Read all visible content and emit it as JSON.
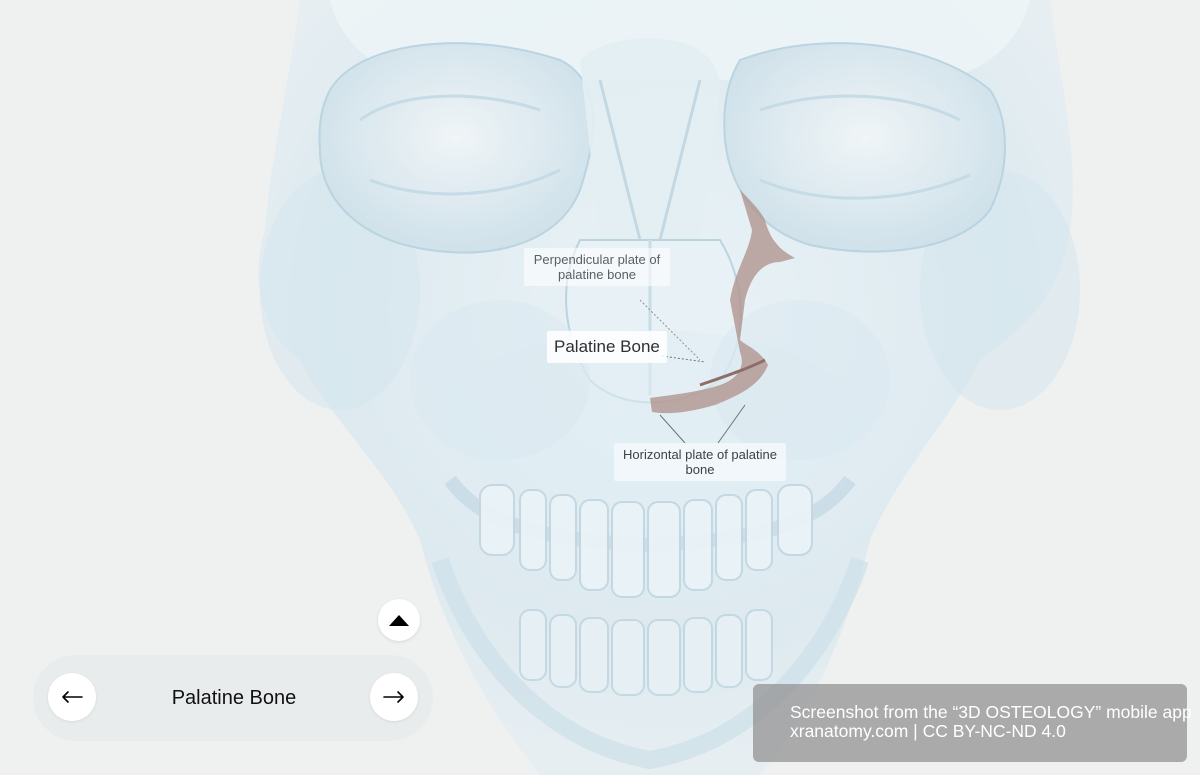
{
  "structure_labels": {
    "perpendicular_plate": "Perpendicular plate of palatine bone",
    "selected_bone": "Palatine Bone",
    "horizontal_plate": "Horizontal plate of palatine bone"
  },
  "controls": {
    "expand_icon": "caret-up-icon",
    "prev_icon": "arrow-left-icon",
    "next_icon": "arrow-right-icon",
    "current_bone": "Palatine Bone"
  },
  "credit": {
    "line1": "Screenshot from the “3D OSTEOLOGY” mobile app",
    "line2": "xranatomy.com | CC BY-NC-ND 4.0"
  },
  "colors": {
    "background": "#eff0f0",
    "bone_tint": "#dcecf3",
    "highlight_bone": "#b0958f",
    "credit_bg": "#969696"
  }
}
